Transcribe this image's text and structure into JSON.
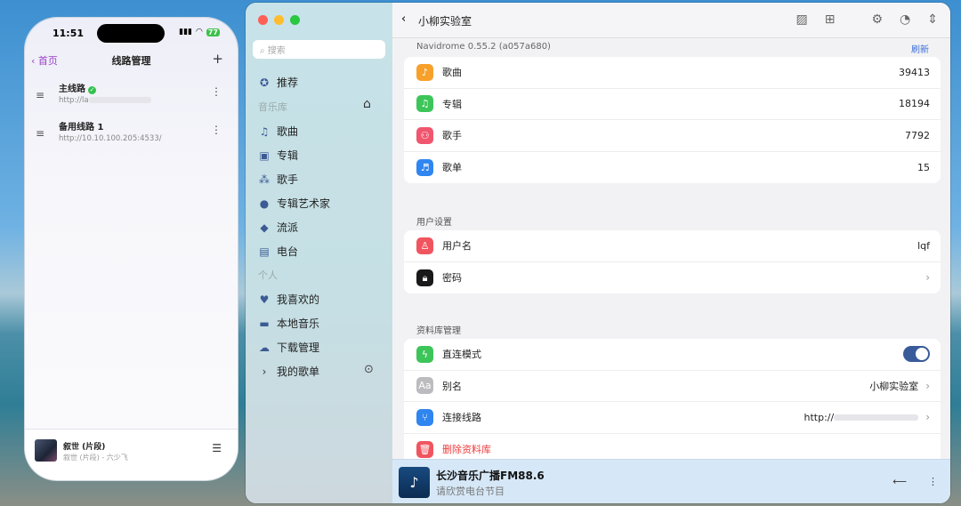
{
  "phone": {
    "time": "11:51",
    "signal": "signal-icon",
    "battery": "77",
    "back": "首页",
    "title": "线路管理",
    "add": "+",
    "routes": [
      {
        "name": "主线路",
        "url": "http://la",
        "active": true
      },
      {
        "name": "备用线路 1",
        "url": "http://10.10.100.205:4533/",
        "active": false
      }
    ],
    "player": {
      "title": "叙世 (片段)",
      "subtitle": "叙世 (片段) - 六少飞"
    }
  },
  "sidebar": {
    "search_placeholder": "搜索",
    "recommend": "推荐",
    "library_header": "音乐库",
    "library": [
      {
        "label": "歌曲",
        "icon": "♫"
      },
      {
        "label": "专辑",
        "icon": "▣"
      },
      {
        "label": "歌手",
        "icon": "⁂"
      },
      {
        "label": "专辑艺术家",
        "icon": "●"
      },
      {
        "label": "流派",
        "icon": "◆"
      },
      {
        "label": "电台",
        "icon": "▤"
      }
    ],
    "personal_header": "个人",
    "personal": [
      {
        "label": "我喜欢的",
        "icon": "♥"
      },
      {
        "label": "本地音乐",
        "icon": "▬"
      },
      {
        "label": "下载管理",
        "icon": "☁"
      }
    ],
    "my_playlists": "我的歌单"
  },
  "main": {
    "title": "小柳实验室",
    "version": "Navidrome 0.55.2 (a057a680)",
    "refresh": "刷新",
    "stats": [
      {
        "label": "歌曲",
        "value": "39413",
        "color": "#f7a12b"
      },
      {
        "label": "专辑",
        "value": "18194",
        "color": "#3dc55a"
      },
      {
        "label": "歌手",
        "value": "7792",
        "color": "#f0566e"
      },
      {
        "label": "歌单",
        "value": "15",
        "color": "#2f86f0"
      }
    ],
    "user_section": "用户设置",
    "username_label": "用户名",
    "username": "lqf",
    "password_label": "密码",
    "lib_section": "资料库管理",
    "direct_label": "直连模式",
    "direct_on": true,
    "alias_label": "别名",
    "alias": "小柳实验室",
    "route_label": "连接线路",
    "route": "http://",
    "delete_label": "删除资料库"
  },
  "player": {
    "title": "长沙音乐广播FM88.6",
    "subtitle": "请欣赏电台节目"
  }
}
